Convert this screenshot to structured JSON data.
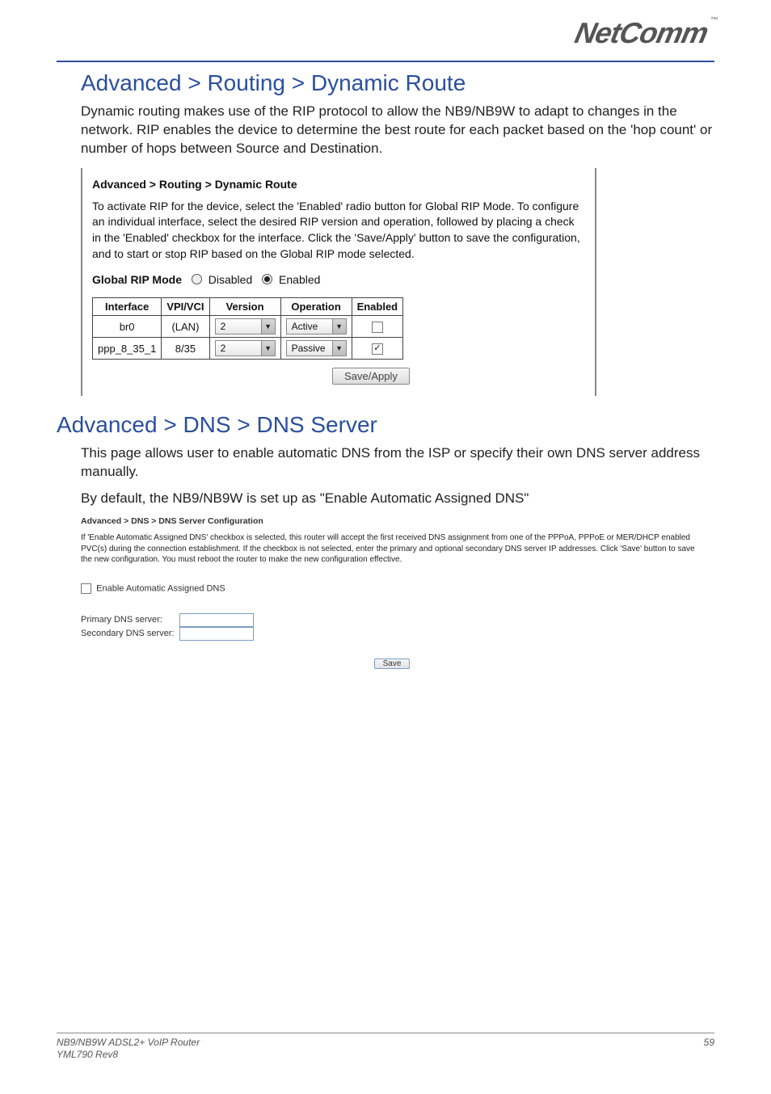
{
  "brand": {
    "name": "NetComm",
    "tm": "™"
  },
  "section1": {
    "heading": "Advanced > Routing > Dynamic Route",
    "intro": "Dynamic routing makes use of the RIP protocol to allow the NB9/NB9W to adapt to changes in the network. RIP enables the device to determine the best route for each packet based on the 'hop count' or number of hops between Source and Destination.",
    "panel": {
      "breadcrumb": "Advanced > Routing > Dynamic Route",
      "body": "To activate RIP for the device, select the 'Enabled' radio button for Global RIP Mode. To configure an individual interface, select the desired RIP version and operation, followed by placing a check in the 'Enabled' checkbox for the interface. Click the 'Save/Apply' button to save the configuration, and to start or stop RIP based on the Global RIP mode selected.",
      "rip_mode_label": "Global RIP Mode",
      "rip_mode_options": {
        "disabled": "Disabled",
        "enabled": "Enabled"
      },
      "rip_mode_selected": "enabled",
      "columns": [
        "Interface",
        "VPI/VCI",
        "Version",
        "Operation",
        "Enabled"
      ],
      "rows": [
        {
          "interface": "br0",
          "vpivci": "(LAN)",
          "version": "2",
          "operation": "Active",
          "enabled": false
        },
        {
          "interface": "ppp_8_35_1",
          "vpivci": "8/35",
          "version": "2",
          "operation": "Passive",
          "enabled": true
        }
      ],
      "save_apply": "Save/Apply"
    }
  },
  "section2": {
    "heading": "Advanced > DNS > DNS Server",
    "intro1": "This page allows user to enable automatic DNS from the ISP or specify their own DNS server address manually.",
    "intro2": "By default, the NB9/NB9W is set up as \"Enable Automatic Assigned DNS\"",
    "panel": {
      "breadcrumb": "Advanced > DNS > DNS Server Configuration",
      "body": "If 'Enable Automatic Assigned DNS' checkbox is selected, this router will accept the first received DNS assignment from one of the PPPoA, PPPoE or MER/DHCP enabled PVC(s) during the connection establishment. If the checkbox is not selected, enter the primary and optional secondary DNS server IP addresses. Click 'Save' button to save the new configuration. You must reboot the router to make the new configuration effective.",
      "auto_dns_label": "Enable Automatic Assigned DNS",
      "auto_dns_checked": false,
      "primary_label": "Primary DNS server:",
      "secondary_label": "Secondary DNS server:",
      "save": "Save"
    }
  },
  "footer": {
    "product": "NB9/NB9W ADSL2+ VoIP Router",
    "rev": "YML790 Rev8",
    "page": "59"
  }
}
